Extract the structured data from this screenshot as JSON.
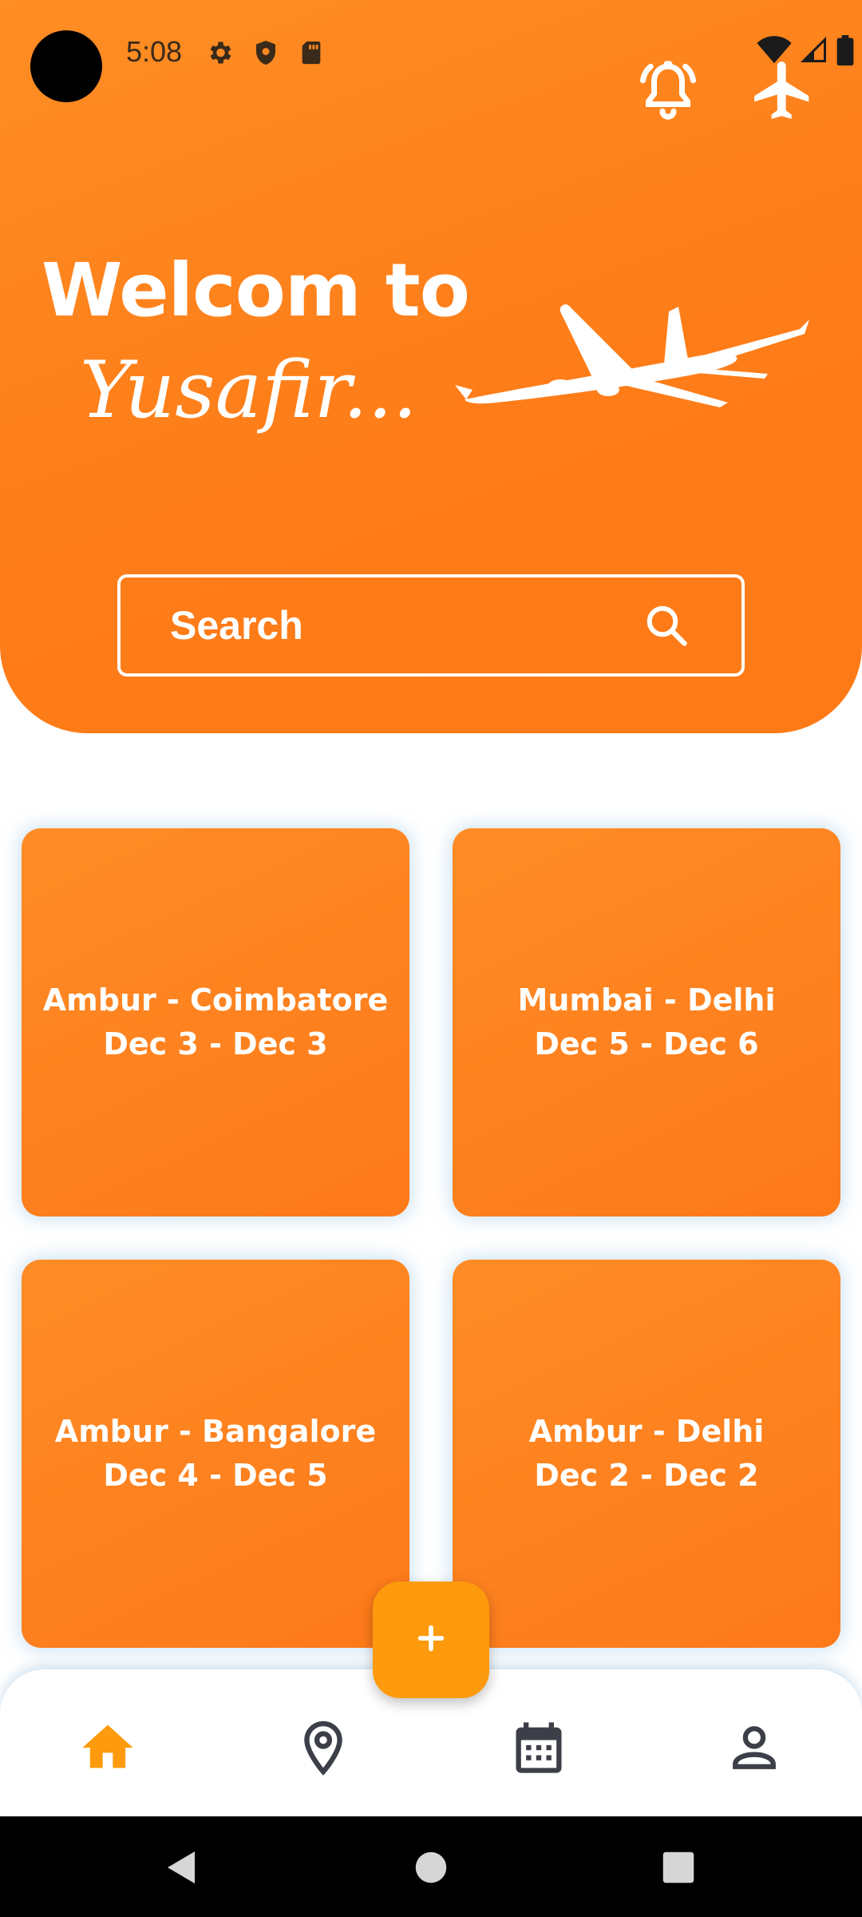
{
  "status_bar": {
    "time": "5:08",
    "left_icons": [
      "gear-icon",
      "shield-icon",
      "sd-card-icon"
    ],
    "right_icons": [
      "wifi-icon",
      "signal-icon",
      "battery-icon"
    ]
  },
  "header": {
    "welcome_text": "Welcom to",
    "brand_text": "Yusafir...",
    "search": {
      "placeholder": "Search"
    },
    "colors": {
      "primary": "#FE8121",
      "text": "#FFFFFF"
    }
  },
  "trips": [
    {
      "route": "Ambur - Coimbatore",
      "dates": "Dec 3 - Dec 3"
    },
    {
      "route": "Mumbai - Delhi",
      "dates": "Dec 5 - Dec 6"
    },
    {
      "route": "Ambur - Bangalore",
      "dates": "Dec 4 - Dec 5"
    },
    {
      "route": "Ambur - Delhi",
      "dates": "Dec 2 - Dec 2"
    }
  ],
  "fab": {
    "label": "+"
  },
  "bottom_nav": {
    "items": [
      "home-icon",
      "location-pin-icon",
      "calendar-icon",
      "profile-icon"
    ],
    "active_color": "#FE9A0D",
    "inactive_color": "#3C3F47"
  }
}
